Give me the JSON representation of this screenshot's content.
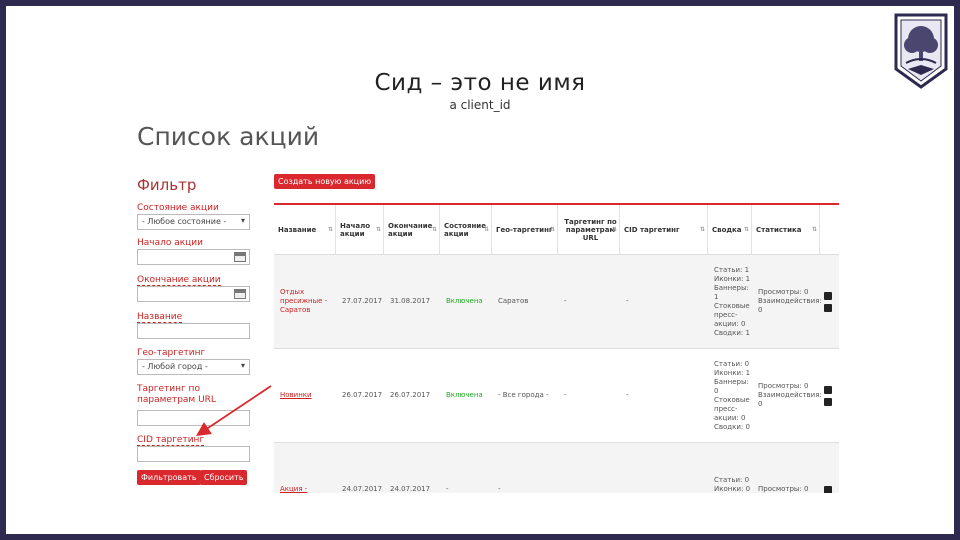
{
  "slide": {
    "title": "Сид – это не имя",
    "subtitle": "а client_id"
  },
  "page": {
    "title": "Список акций"
  },
  "sidebar": {
    "heading": "Фильтр",
    "status_label": "Состояние акции",
    "status_value": "- Любое состояние -",
    "start_label": "Начало акции",
    "end_label": "Окончание акции",
    "name_label": "Название",
    "geo_label": "Гео-таргетинг",
    "geo_value": "- Любой город -",
    "url_label": "Таргетинг по параметрам URL",
    "cid_label": "CID таргетинг",
    "filter_button": "Фильтровать",
    "reset_button": "Сбросить"
  },
  "toolbar": {
    "create_button": "Создать новую акцию"
  },
  "table": {
    "headers": [
      "Название",
      "Начало акции",
      "Окончание акции",
      "Состояние акции",
      "Гео-таргетинг",
      "Таргетинг по параметрам URL",
      "CID таргетинг",
      "Сводка",
      "Статистика"
    ],
    "rows": [
      {
        "name": "Отдых пресижные - Саратов",
        "start": "27.07.2017",
        "end": "31.08.2017",
        "status": "Включена",
        "geo": "Саратов",
        "url": "-",
        "cid": "-",
        "summary": "Статьи: 1 Иконки: 1 Баннеры: 1 Стоковые пресс-акции: 0 Сводки: 1",
        "stats": "Просмотры: 0 Взаимодействия: 0"
      },
      {
        "name": "Новинки",
        "start": "26.07.2017",
        "end": "26.07.2017",
        "status": "Включена",
        "geo": "- Все города -",
        "url": "-",
        "cid": "-",
        "summary": "Статьи: 0 Иконки: 1 Баннеры: 0 Стоковые пресс-акции: 0 Сводки: 0",
        "stats": "Просмотры: 0 Взаимодействия: 0"
      },
      {
        "name": "Акция -",
        "start": "24.07.2017",
        "end": "24.07.2017",
        "status": "-",
        "geo": "-",
        "url": "",
        "cid": "",
        "summary": "Статьи: 0 Иконки: 0 Баннеры:",
        "stats": "Просмотры: 0"
      }
    ]
  },
  "colors": {
    "accent": "#d9282e",
    "frame": "#2e2a4f",
    "status_active": "#22aa22"
  },
  "icons": {
    "logo": "tree-shield-logo-icon",
    "calendar": "calendar-icon",
    "edit": "edit-icon",
    "delete": "delete-icon",
    "arrow": "annotation-arrow"
  }
}
